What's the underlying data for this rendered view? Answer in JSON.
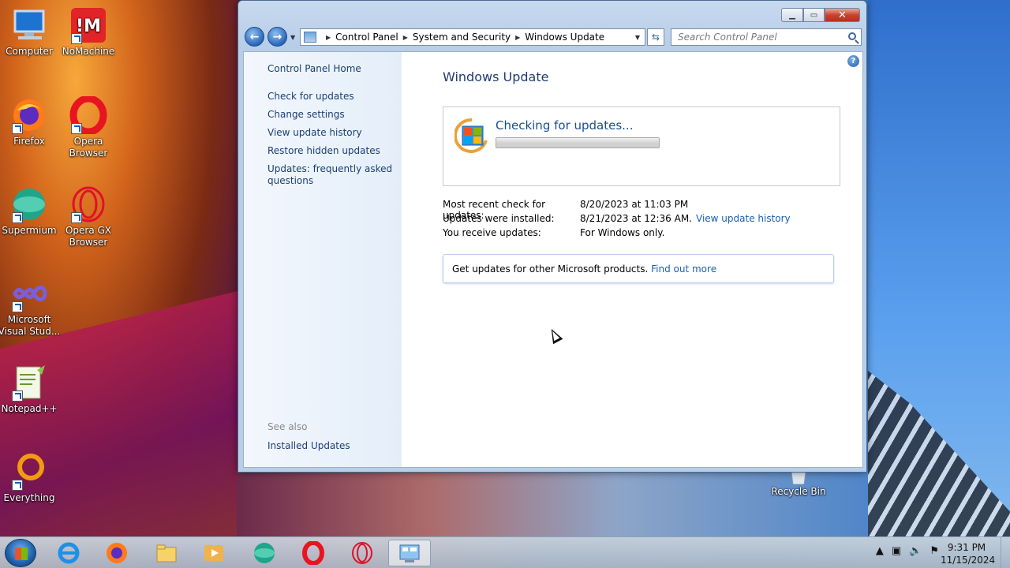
{
  "desktop": {
    "icons": [
      {
        "label": "Computer"
      },
      {
        "label": "NoMachine"
      },
      {
        "label": "Firefox"
      },
      {
        "label": "Opera Browser"
      },
      {
        "label": "Supermium"
      },
      {
        "label": "Opera GX Browser"
      },
      {
        "label": "Microsoft Visual Stud..."
      },
      {
        "label": "Notepad++"
      },
      {
        "label": "Everything"
      },
      {
        "label": "Recycle Bin"
      }
    ]
  },
  "window": {
    "breadcrumb": [
      "Control Panel",
      "System and Security",
      "Windows Update"
    ],
    "search_placeholder": "Search Control Panel",
    "sidebar": {
      "home": "Control Panel Home",
      "tasks": [
        "Check for updates",
        "Change settings",
        "View update history",
        "Restore hidden updates",
        "Updates: frequently asked questions"
      ],
      "see_also": "See also",
      "see_also_items": [
        "Installed Updates"
      ]
    },
    "main": {
      "title": "Windows Update",
      "status": "Checking for updates...",
      "info": [
        {
          "label": "Most recent check for updates:",
          "value": "8/20/2023 at 11:03 PM",
          "link": ""
        },
        {
          "label": "Updates were installed:",
          "value": "8/21/2023 at 12:36 AM.",
          "link": "View update history"
        },
        {
          "label": "You receive updates:",
          "value": "For Windows only.",
          "link": ""
        }
      ],
      "other_products": "Get updates for other Microsoft products.",
      "find_out_more": "Find out more"
    }
  },
  "taskbar": {
    "time": "9:31 PM",
    "date": "11/15/2024"
  }
}
